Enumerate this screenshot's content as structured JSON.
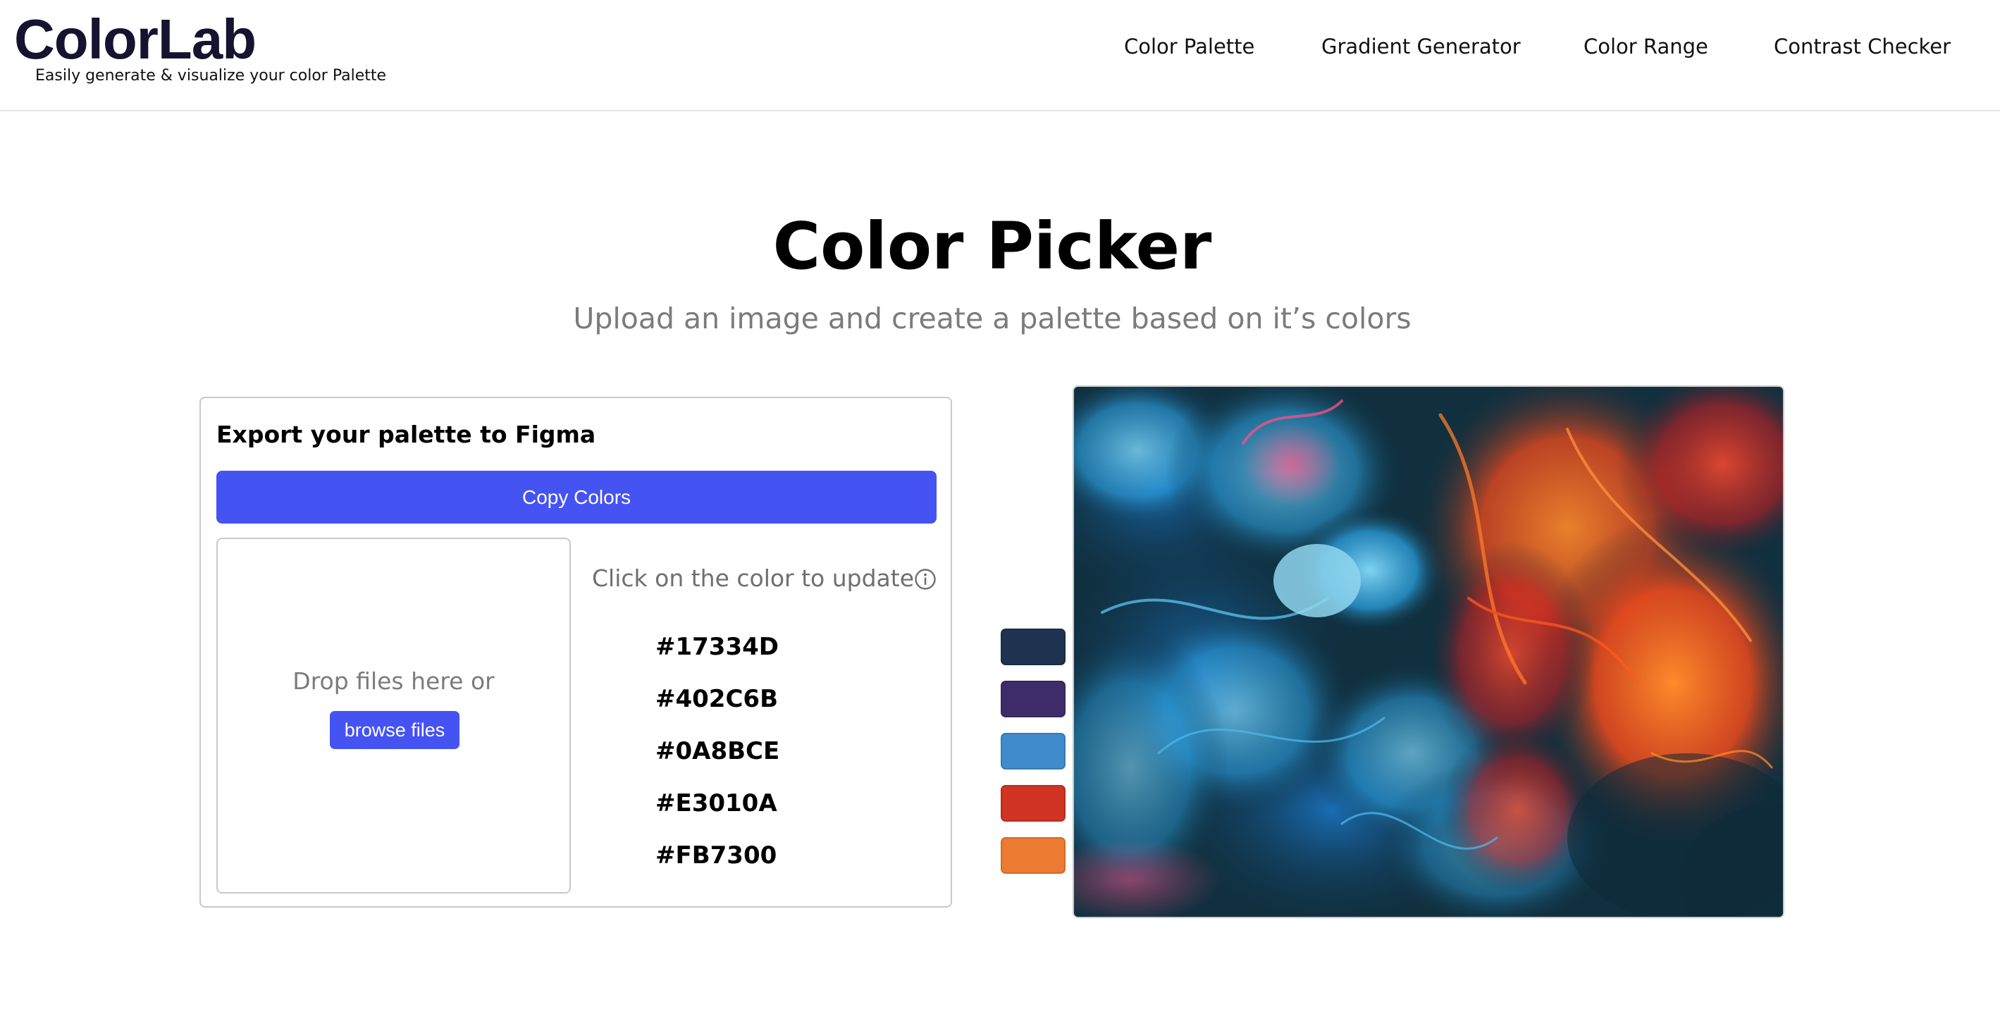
{
  "header": {
    "logo": "ColorLab",
    "tagline": "Easily generate & visualize your color Palette",
    "nav": [
      {
        "label": "Color Palette"
      },
      {
        "label": "Gradient Generator"
      },
      {
        "label": "Color Range"
      },
      {
        "label": "Contrast Checker"
      }
    ]
  },
  "hero": {
    "title": "Color Picker",
    "subtitle": "Upload an image and create a palette based on it’s colors"
  },
  "export_card": {
    "title": "Export your palette to Figma",
    "copy_button": "Copy Colors",
    "dropzone": {
      "text": "Drop files here or",
      "browse_button": "browse files"
    },
    "hint": "Click on the color to update",
    "hint_icon": "info-icon",
    "colors": [
      {
        "hex": "#17334D"
      },
      {
        "hex": "#402C6B"
      },
      {
        "hex": "#0A8BCE"
      },
      {
        "hex": "#E3010A"
      },
      {
        "hex": "#FB7300"
      }
    ],
    "swatch_colors": [
      "#1d3350",
      "#3e2c69",
      "#3f8bcb",
      "#d13423",
      "#ed7a31"
    ]
  },
  "preview_image": {
    "description_icon": "abstract-ink-image"
  },
  "theme": {
    "accent": "#4553f2",
    "logo_color": "#15132f",
    "muted_text": "#7b7b7b"
  }
}
